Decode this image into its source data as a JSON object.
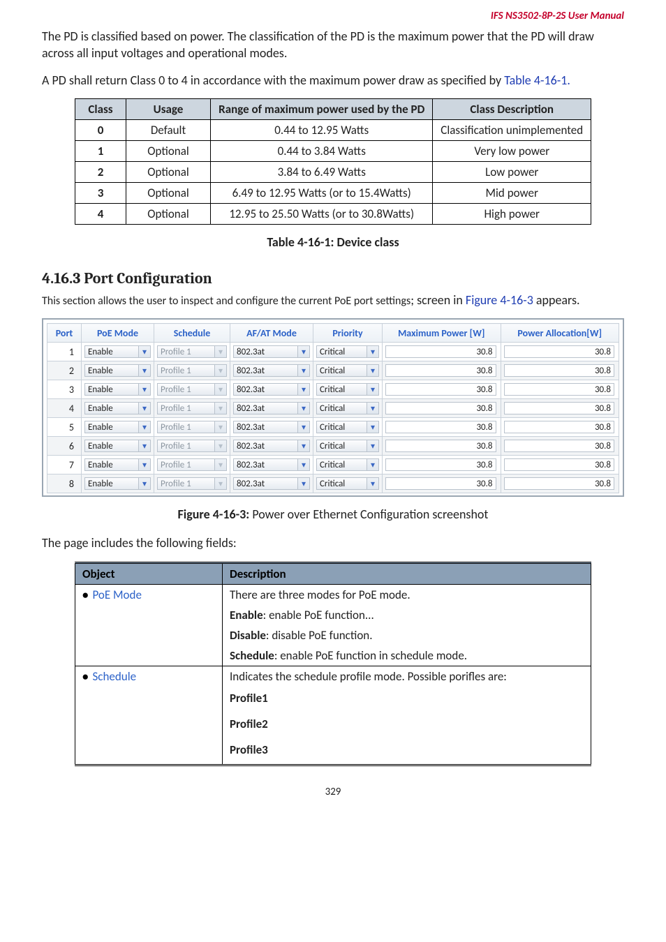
{
  "header": {
    "title": "IFS  NS3502-8P-2S   User Manual"
  },
  "intro": {
    "p1": "The PD is classified based on power. The classification of the PD is the maximum power that the PD will draw across all input voltages and operational modes.",
    "p2a": "A PD shall return Class 0 to 4 in accordance with the maximum power draw as specified by ",
    "p2_ref": "Table 4-16-1.",
    "p2_ref_end": ""
  },
  "class_table": {
    "headers": {
      "class": "Class",
      "usage": "Usage",
      "range": "Range of maximum power used by the PD",
      "desc": "Class Description"
    },
    "rows": [
      {
        "class": "0",
        "usage": "Default",
        "range": "0.44 to 12.95 Watts",
        "desc": "Classification unimplemented"
      },
      {
        "class": "1",
        "usage": "Optional",
        "range": "0.44 to 3.84 Watts",
        "desc": "Very low power"
      },
      {
        "class": "2",
        "usage": "Optional",
        "range": "3.84 to 6.49 Watts",
        "desc": "Low power"
      },
      {
        "class": "3",
        "usage": "Optional",
        "range": "6.49 to 12.95 Watts (or to 15.4Watts)",
        "desc": "Mid power"
      },
      {
        "class": "4",
        "usage": "Optional",
        "range": "12.95 to 25.50 Watts (or to 30.8Watts)",
        "desc": "High power"
      }
    ],
    "caption": "Table 4-16-1: Device class"
  },
  "section": {
    "number_title": "4.16.3 Port Configuration",
    "intro_a": "This section allows the user to inspect and configure the current PoE port settings",
    "intro_b": "; screen in ",
    "intro_ref": "Figure 4-16-3",
    "intro_c": " appears."
  },
  "poe": {
    "headers": {
      "port": "Port",
      "mode": "PoE Mode",
      "schedule": "Schedule",
      "afat": "AF/AT Mode",
      "priority": "Priority",
      "max": "Maximum Power [W]",
      "alloc": "Power Allocation[W]"
    },
    "options": {
      "mode": "Enable",
      "schedule": "Profile 1",
      "afat": "802.3at",
      "priority": "Critical"
    },
    "rows": [
      {
        "port": "1",
        "max": "30.8",
        "alloc": "30.8"
      },
      {
        "port": "2",
        "max": "30.8",
        "alloc": "30.8"
      },
      {
        "port": "3",
        "max": "30.8",
        "alloc": "30.8"
      },
      {
        "port": "4",
        "max": "30.8",
        "alloc": "30.8"
      },
      {
        "port": "5",
        "max": "30.8",
        "alloc": "30.8"
      },
      {
        "port": "6",
        "max": "30.8",
        "alloc": "30.8"
      },
      {
        "port": "7",
        "max": "30.8",
        "alloc": "30.8"
      },
      {
        "port": "8",
        "max": "30.8",
        "alloc": "30.8"
      }
    ],
    "caption_lead": "Figure 4-16-3: ",
    "caption_rest": "Power over Ethernet Configuration screenshot"
  },
  "fields_intro": "The page includes the following fields:",
  "obj_table": {
    "headers": {
      "obj": "Object",
      "desc": "Description"
    },
    "poe_mode": {
      "label": "PoE Mode",
      "l1": "There are three modes for PoE mode.",
      "l2a": "Enable",
      "l2b": ": enable PoE function...",
      "l3a": "Disable",
      "l3b": ": disable PoE function.",
      "l4a": "Schedule",
      "l4b": ": enable PoE function in schedule mode."
    },
    "schedule": {
      "label": "Schedule",
      "l1": "Indicates the schedule profile mode. Possible porifles are:",
      "p1": "Profile1",
      "p2": "Profile2",
      "p3": "Profile3"
    }
  },
  "footer": {
    "page": "329"
  }
}
